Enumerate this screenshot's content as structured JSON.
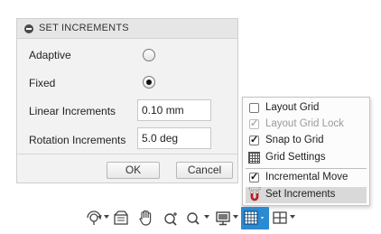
{
  "dialog": {
    "title": "SET INCREMENTS",
    "rows": [
      {
        "label": "Adaptive",
        "type": "radio",
        "checked": false
      },
      {
        "label": "Fixed",
        "type": "radio",
        "checked": true
      },
      {
        "label": "Linear Increments",
        "type": "input",
        "value": "0.10 mm"
      },
      {
        "label": "Rotation Increments",
        "type": "input",
        "value": "5.0 deg"
      }
    ],
    "ok_label": "OK",
    "cancel_label": "Cancel"
  },
  "menu": {
    "items": [
      {
        "label": "Layout Grid",
        "checked": false,
        "enabled": true
      },
      {
        "label": "Layout Grid Lock",
        "checked": true,
        "enabled": false
      },
      {
        "label": "Snap to Grid",
        "checked": true,
        "enabled": true
      },
      {
        "label": "Grid Settings",
        "icon": "grid-icon"
      },
      {
        "label": "Incremental Move",
        "checked": true,
        "enabled": true
      },
      {
        "label": "Set Increments",
        "icon": "magnet-icon",
        "highlighted": true
      }
    ]
  },
  "toolbar": {
    "tools": [
      "orbit-icon",
      "look-at-icon",
      "pan-hand-icon",
      "zoom-window-icon",
      "zoom-icon",
      "display-settings-icon",
      "grid-snaps-icon",
      "viewports-icon"
    ],
    "accent": "#2a8ad2"
  },
  "colors": {
    "dialog_bg": "#f2f2f2",
    "highlight": "#d9d9d9",
    "check": "#111111"
  }
}
